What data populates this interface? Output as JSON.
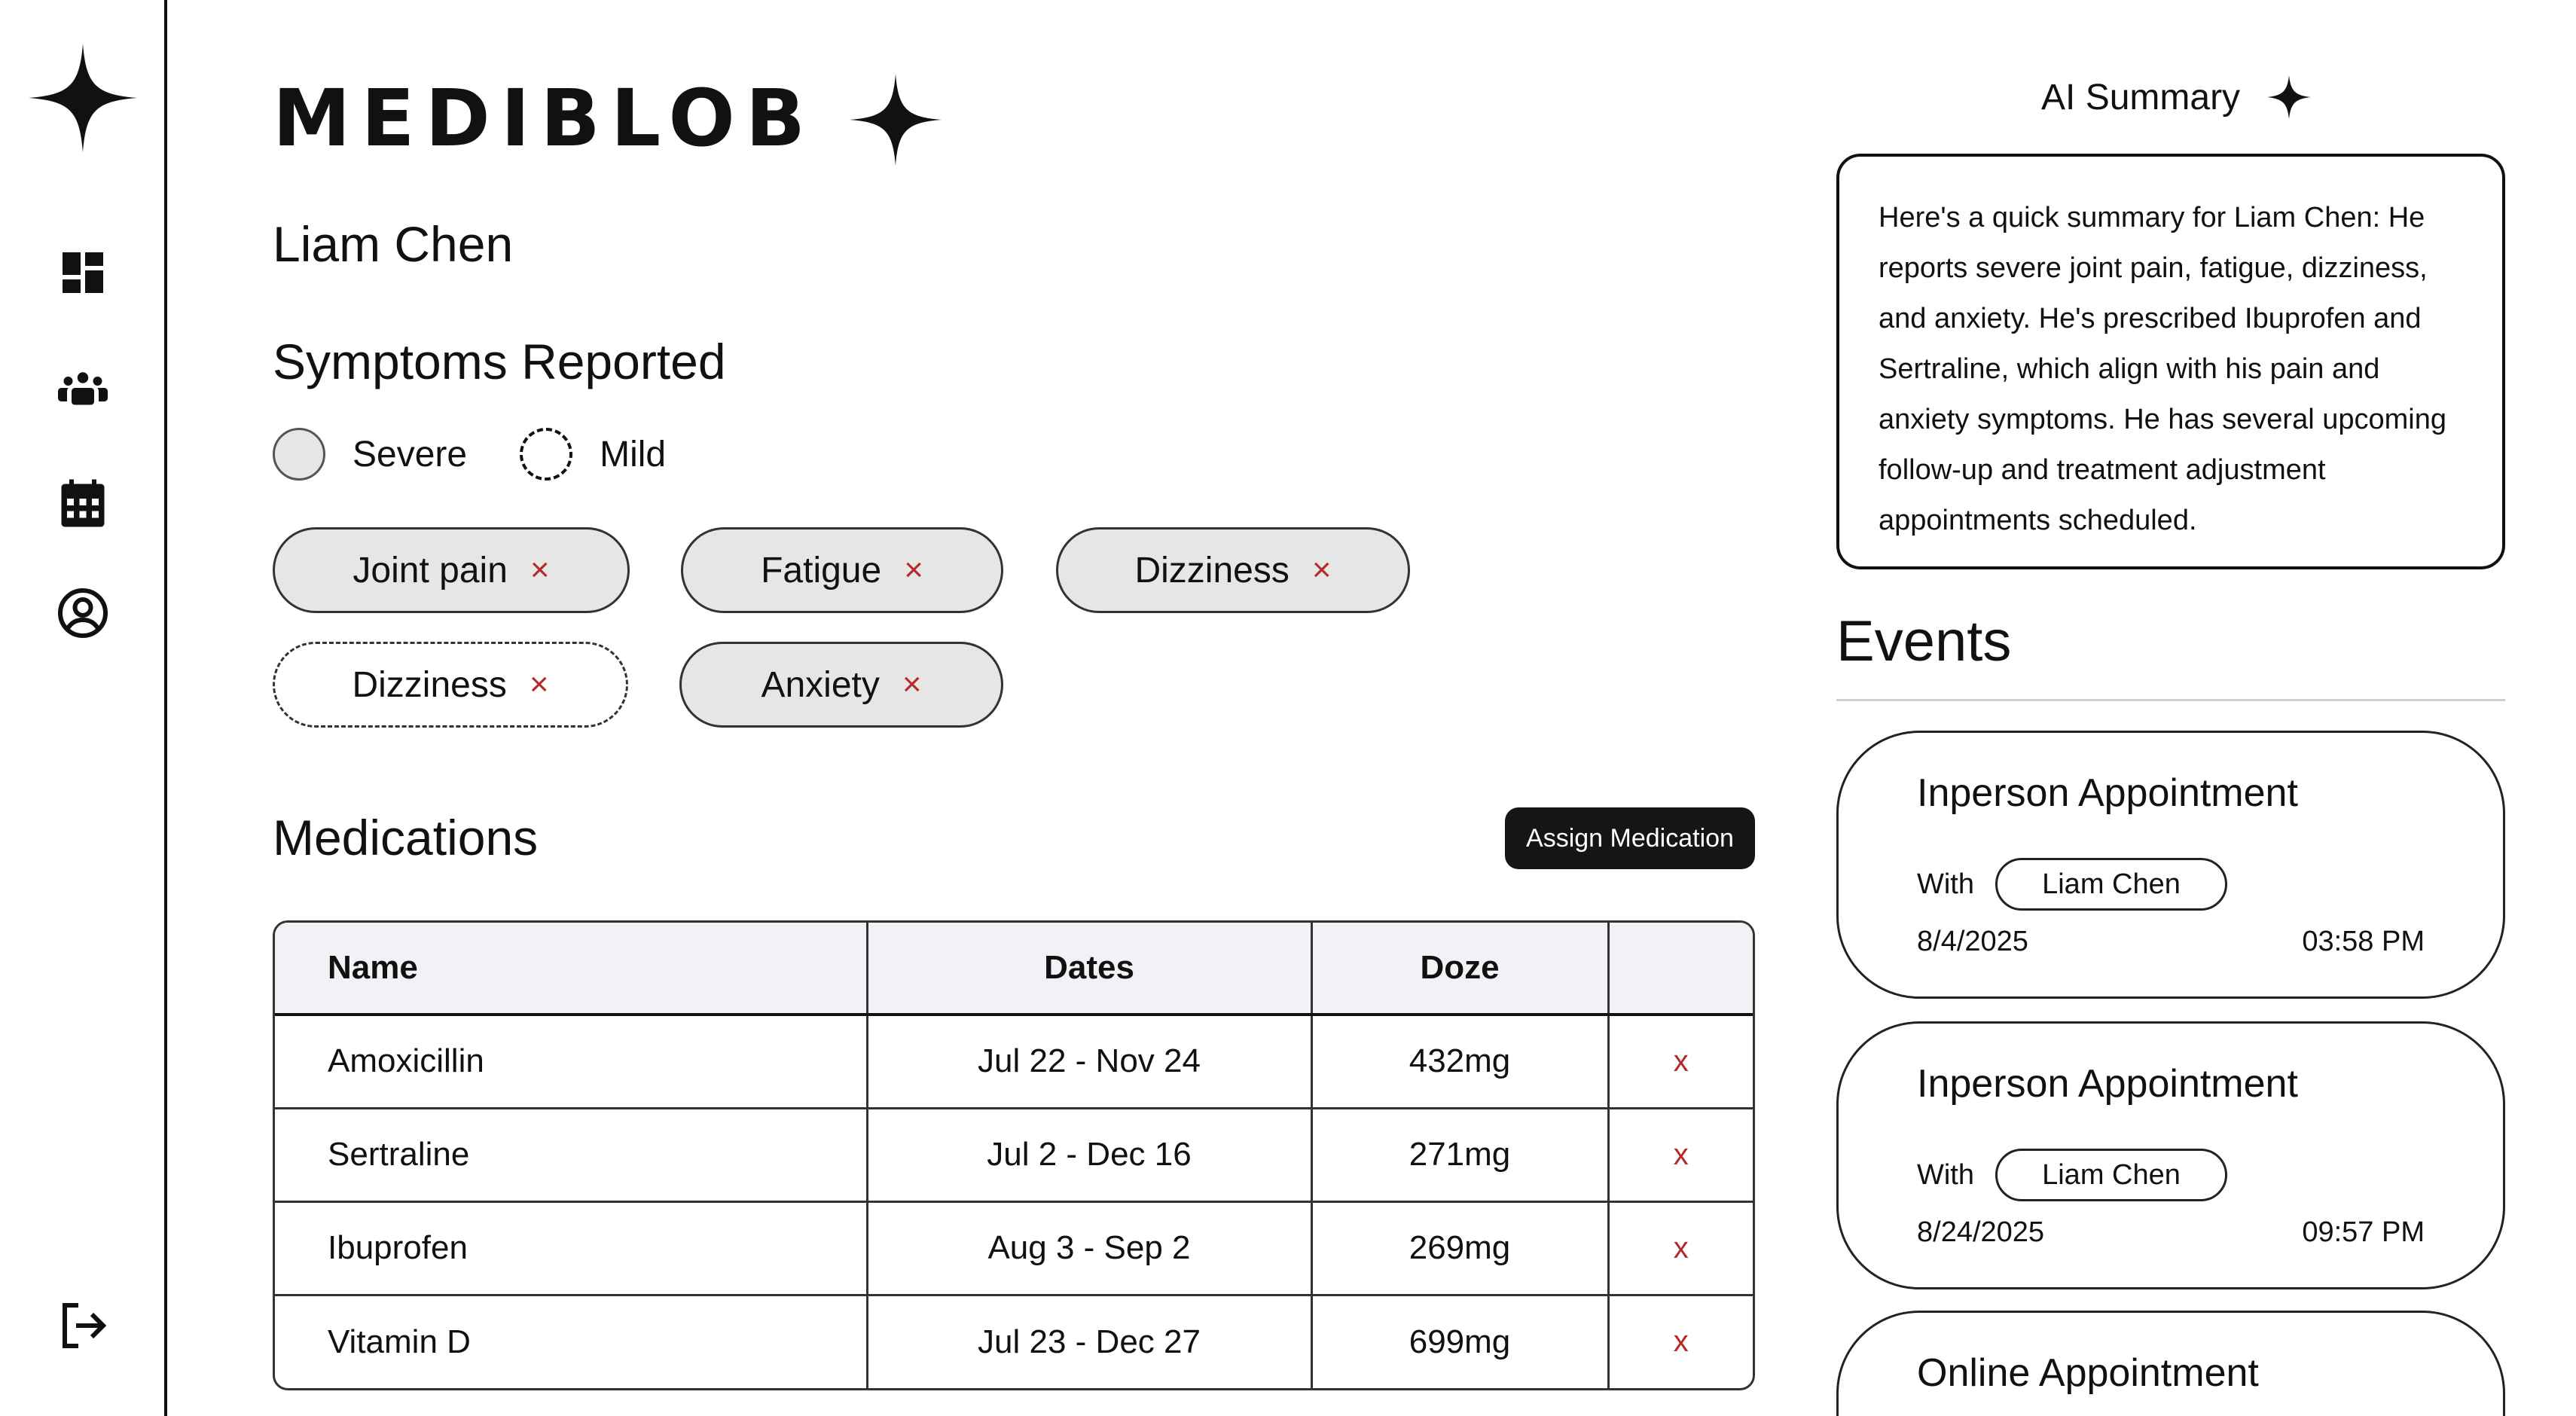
{
  "app": {
    "brand": "MEDIBLOB"
  },
  "sidebar": {
    "items": [
      {
        "name": "dashboard",
        "icon": "dashboard-icon"
      },
      {
        "name": "patients",
        "icon": "group-icon"
      },
      {
        "name": "calendar",
        "icon": "calendar-icon"
      },
      {
        "name": "profile",
        "icon": "account-circle-icon"
      }
    ],
    "logout_icon": "logout-icon"
  },
  "patient": {
    "name": "Liam Chen"
  },
  "symptoms": {
    "title": "Symptoms Reported",
    "legend": {
      "severe": "Severe",
      "mild": "Mild"
    },
    "chips": [
      {
        "label": "Joint pain",
        "severity": "severe"
      },
      {
        "label": "Fatigue",
        "severity": "severe"
      },
      {
        "label": "Dizziness",
        "severity": "severe"
      },
      {
        "label": "Dizziness",
        "severity": "mild"
      },
      {
        "label": "Anxiety",
        "severity": "severe"
      }
    ],
    "remove_glyph": "×"
  },
  "medications": {
    "title": "Medications",
    "assign_label": "Assign Medication",
    "columns": [
      "Name",
      "Dates",
      "Doze",
      ""
    ],
    "rows": [
      {
        "name": "Amoxicillin",
        "dates": "Jul 22 - Nov 24",
        "doze": "432mg",
        "delete": "x"
      },
      {
        "name": "Sertraline",
        "dates": "Jul 2 - Dec 16",
        "doze": "271mg",
        "delete": "x"
      },
      {
        "name": "Ibuprofen",
        "dates": "Aug 3 - Sep 2",
        "doze": "269mg",
        "delete": "x"
      },
      {
        "name": "Vitamin D",
        "dates": "Jul 23 - Dec 27",
        "doze": "699mg",
        "delete": "x"
      }
    ]
  },
  "ai_summary": {
    "title": "AI Summary",
    "icon": "sparkle-icon",
    "text": "Here's a quick summary for Liam Chen: He reports severe joint pain, fatigue, dizziness, and anxiety. He's prescribed Ibuprofen and Sertraline, which align with his pain and anxiety symptoms. He has several upcoming follow-up and treatment adjustment appointments scheduled."
  },
  "events": {
    "title": "Events",
    "items": [
      {
        "title": "Inperson Appointment",
        "with_label": "With",
        "person": "Liam Chen",
        "date": "8/4/2025",
        "time": "03:58 PM"
      },
      {
        "title": "Inperson Appointment",
        "with_label": "With",
        "person": "Liam Chen",
        "date": "8/24/2025",
        "time": "09:57 PM"
      },
      {
        "title": "Online Appointment"
      }
    ]
  },
  "colors": {
    "accent": "#151515",
    "chip_bg": "#e6e6e6",
    "remove": "#b52a2a",
    "header_bg": "#f1f2f5"
  }
}
